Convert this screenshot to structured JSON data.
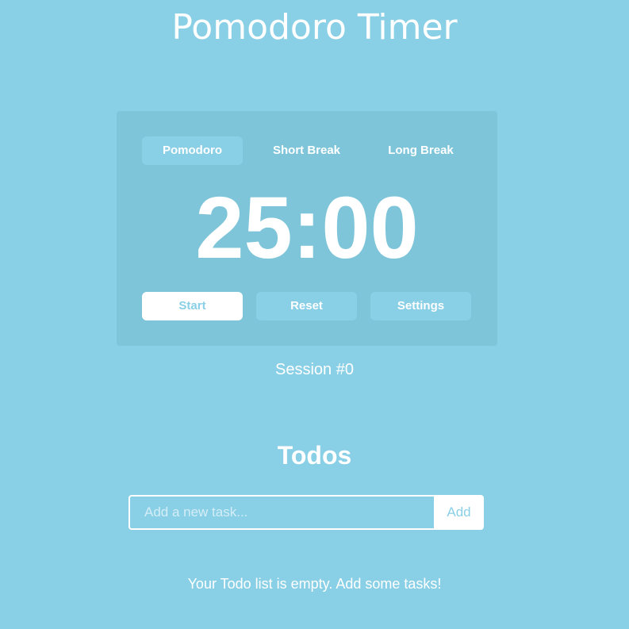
{
  "app": {
    "title": "Pomodoro Timer"
  },
  "timer": {
    "modes": [
      {
        "label": "Pomodoro",
        "active": true
      },
      {
        "label": "Short Break",
        "active": false
      },
      {
        "label": "Long Break",
        "active": false
      }
    ],
    "time": "25:00",
    "controls": {
      "start_label": "Start",
      "reset_label": "Reset",
      "settings_label": "Settings"
    }
  },
  "session": {
    "label": "Session #0"
  },
  "todos": {
    "heading": "Todos",
    "input_placeholder": "Add a new task...",
    "input_value": "",
    "add_label": "Add",
    "empty_message": "Your Todo list is empty. Add some tasks!"
  },
  "colors": {
    "background": "#89cfe6",
    "card": "#7fc5da",
    "text": "#ffffff"
  }
}
